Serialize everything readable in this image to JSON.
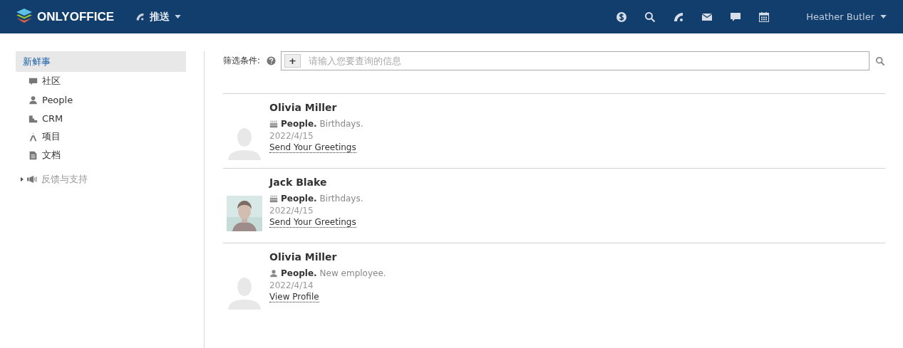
{
  "header": {
    "logo": "ONLYOFFICE",
    "module": "推送",
    "user": "Heather Butler",
    "icons": [
      {
        "kind": "dollar"
      },
      {
        "kind": "search"
      },
      {
        "kind": "feed"
      },
      {
        "kind": "mail"
      },
      {
        "kind": "chat"
      },
      {
        "kind": "calendar"
      }
    ]
  },
  "sidebar": {
    "items": [
      {
        "label": "新鲜事",
        "kind": "none",
        "selected": true
      },
      {
        "label": "社区",
        "kind": "chat",
        "selected": false
      },
      {
        "label": "People",
        "kind": "person",
        "selected": false
      },
      {
        "label": "CRM",
        "kind": "crm",
        "selected": false
      },
      {
        "label": "项目",
        "kind": "project",
        "selected": false
      },
      {
        "label": "文档",
        "kind": "doc",
        "selected": false
      }
    ],
    "support": {
      "label": "反馈与支持",
      "expanded": false
    }
  },
  "filter": {
    "label": "筛选条件:",
    "add": "+",
    "placeholder": "请输入您要查询的信息"
  },
  "feed": [
    {
      "name": "Olivia Miller",
      "avatar": {
        "kind": "silhouette"
      },
      "event_icon": {
        "kind": "cake"
      },
      "module": "People.",
      "event": "Birthdays.",
      "date": "2022/4/15",
      "link": "Send Your Greetings"
    },
    {
      "name": "Jack Blake",
      "event_icon": {
        "kind": "cake"
      },
      "module": "People.",
      "event": "Birthdays.",
      "date": "2022/4/15",
      "link": "Send Your Greetings"
    },
    {
      "name": "Olivia Miller",
      "avatar": {
        "kind": "silhouette"
      },
      "event_icon": {
        "kind": "person"
      },
      "module": "People.",
      "event": "New employee.",
      "date": "2022/4/14",
      "link": "View Profile"
    }
  ]
}
